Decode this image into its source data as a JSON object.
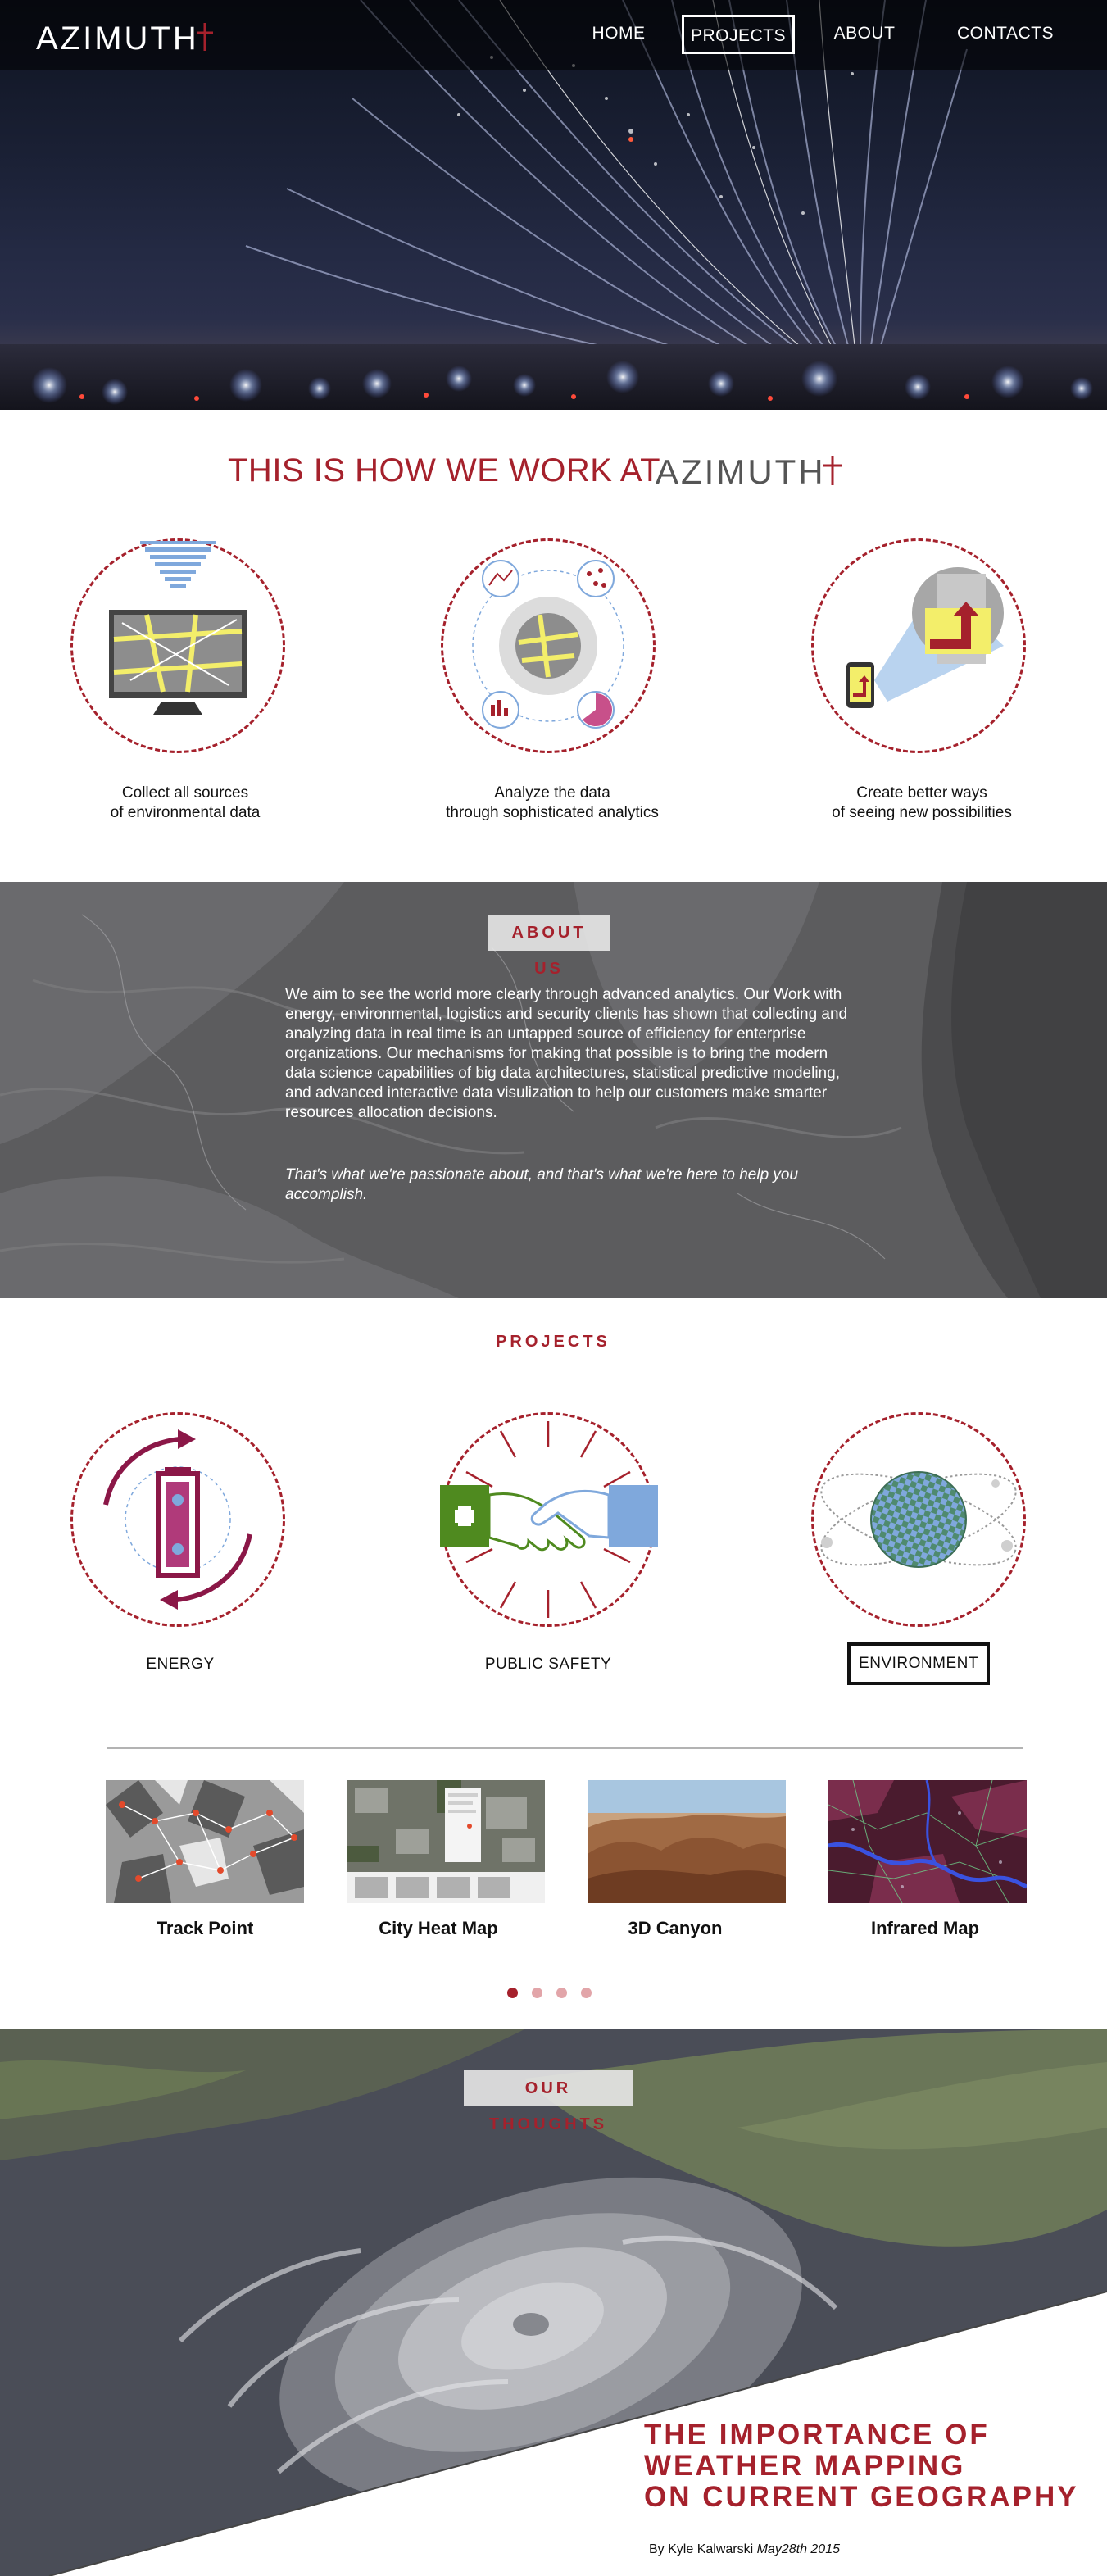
{
  "brand": {
    "logo_text": "AZIMUTH",
    "accent_color": "#a5212c"
  },
  "nav": {
    "items": [
      {
        "label": "HOME",
        "active": false
      },
      {
        "label": "PROJECTS",
        "active": true
      },
      {
        "label": "ABOUT",
        "active": false
      },
      {
        "label": "CONTACTS",
        "active": false
      }
    ]
  },
  "how_we_work": {
    "title": "THIS IS HOW WE WORK AT",
    "steps": [
      {
        "line1": "Collect all sources",
        "line2": "of  environmental data",
        "icon": "monitor-data-collection-icon"
      },
      {
        "line1": "Analyze the data",
        "line2": "through sophisticated analytics",
        "icon": "analytics-network-icon"
      },
      {
        "line1": "Create better ways",
        "line2": "of seeing new possibilities",
        "icon": "phone-projection-icon"
      }
    ]
  },
  "about": {
    "tag": "ABOUT US",
    "body": "We aim to see the world more clearly through advanced analytics. Our Work with energy, environmental, logistics and security clients has shown that collecting and analyzing data in real time is an untapped source of efficiency for enterprise organizations. Our mechanisms for making that possible is to bring the modern data science capabilities of big data architectures, statistical predictive modeling, and advanced interactive data visulization to help our customers make smarter resources allocation decisions.",
    "quote": "That's what we're passionate about, and that's what we're here to help you accomplish."
  },
  "projects": {
    "title": "PROJECTS",
    "categories": [
      {
        "label": "ENERGY",
        "icon": "battery-cycle-icon",
        "selected": false
      },
      {
        "label": "PUBLIC SAFETY",
        "icon": "handshake-icon",
        "selected": false
      },
      {
        "label": "ENVIRONMENT",
        "icon": "globe-orbit-icon",
        "selected": true
      }
    ],
    "items": [
      {
        "label": "Track Point"
      },
      {
        "label": "City Heat Map"
      },
      {
        "label": "3D Canyon"
      },
      {
        "label": "Infrared Map"
      }
    ],
    "pagination": {
      "pages": 4,
      "current": 1
    }
  },
  "thoughts": {
    "tag": "OUR THOUGHTS",
    "article": {
      "title_lines": [
        "THE IMPORTANCE OF",
        "WEATHER MAPPING",
        "ON CURRENT GEOGRAPHY"
      ],
      "author": "By Kyle Kalwarski",
      "date": "May28th 2015"
    }
  }
}
